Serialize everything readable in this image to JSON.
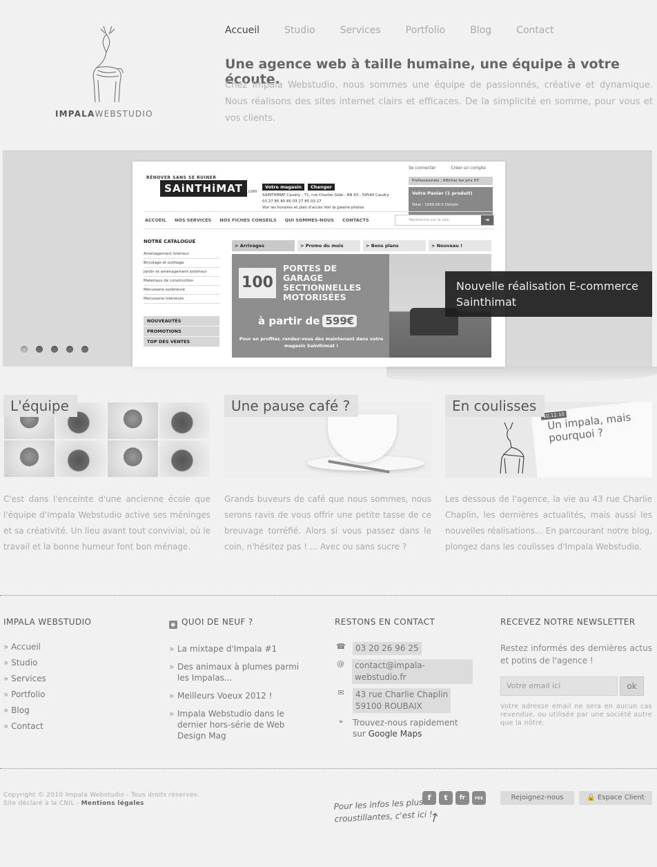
{
  "brand": {
    "name_bold": "IMPALA",
    "name_light": "WEBSTUDIO"
  },
  "nav": [
    {
      "label": "Accueil",
      "active": true
    },
    {
      "label": "Studio"
    },
    {
      "label": "Services"
    },
    {
      "label": "Portfolio"
    },
    {
      "label": "Blog"
    },
    {
      "label": "Contact"
    }
  ],
  "intro": {
    "title": "Une agence web à taille humaine, une équipe à votre écoute.",
    "text": "Chez Impala Webstudio, nous sommes une équipe de passionnés, créative et dynamique. Nous réalisons des sites internet clairs et efficaces. De la simplicité en somme, pour vous et vos clients."
  },
  "slider": {
    "caption_line1": "Nouvelle réalisation E-commerce",
    "caption_line2": "Sainthimat",
    "dots_active": 1,
    "shot": {
      "top_links": [
        "Se connecter",
        "Créer un compte"
      ],
      "brand_tag": "RÉNOVER SANS SE RUINER",
      "brand": "SAiNTHiMAT",
      "brand_www": "www.",
      "brand_com": ".com",
      "store_header": "Votre magasin",
      "store_change": "Changer",
      "store_line1": "SAINTHIMAT Caudry - 71, rue Charles Gide - RN 43 - 59540 Caudry",
      "store_line2": "03 27 85 85 85   03 27 85 03 27",
      "store_line3": "Voir les horaires et plan d'accès   Voir la galerie photos",
      "pro": "Professionnels : Afficher les prix HT",
      "cart_title": "Votre Panier (1 produit)",
      "cart_total": "Total : 1090.00 €     Détails",
      "menu": [
        "ACCUEIL",
        "NOS SERVICES",
        "NOS FICHES CONSEILS",
        "QUI SOMMES-NOUS",
        "CONTACTS"
      ],
      "search_placeholder": "Recherche sur le site",
      "catalog_title": "NOTRE CATALOGUE",
      "catalog": [
        "Aménagement intérieur",
        "Bricolage et outillage",
        "Jardin et aménagement extérieur",
        "Matériaux de construction",
        "Menuiserie extérieure",
        "Menuiserie intérieure"
      ],
      "promos": [
        "NOUVEAUTÉS",
        "PROMOTIONS",
        "TOP DES VENTES"
      ],
      "tabs": [
        "> Arrivages",
        "> Promo du mois",
        "> Bons plans",
        "> Nouveau !"
      ],
      "banner_num": "100",
      "banner_title": "PORTES DE GARAGE SECTIONNELLES MOTORISÉES",
      "banner_from": "à partir de",
      "banner_price": "599€",
      "banner_info": "Pour en profiter, rendez-vous dès maintenant dans votre magasin Sainthimat !"
    }
  },
  "columns": [
    {
      "title": "L'équipe",
      "text": "C'est dans l'enceinte d'une ancienne école que l'équipe d'Impala Webstudio active ses méninges et sa créativité. Un lieu avant tout convivial, où le travail et la bonne humeur font bon ménage."
    },
    {
      "title": "Une pause café ?",
      "text": "Grands buveurs de café que nous sommes, nous serons ravis de vous offrir une petite tasse de ce breuvage torréfié. Alors si vous passez dans le coin, n'hésitez pas ! ... Avec ou sans sucre ?"
    },
    {
      "title": "En coulisses",
      "blog_date": "10.12.10",
      "blog_title": "Un impala, mais pourquoi ?",
      "text": "Les dessous de l'agence, la vie au 43 rue Charlie Chaplin, les dernières actualités, mais aussi les nouvelles réalisations... En parcourant notre blog, plongez dans les coulisses d'Impala Webstudio."
    }
  ],
  "footer": {
    "col1": {
      "title": "IMPALA WEBSTUDIO",
      "links": [
        "Accueil",
        "Studio",
        "Services",
        "Portfolio",
        "Blog",
        "Contact"
      ]
    },
    "col2": {
      "title": "QUOI DE NEUF ?",
      "items": [
        "La mixtape d'Impala #1",
        "Des animaux à plumes parmi les Impalas...",
        "Meilleurs Voeux 2012 !",
        "Impala Webstudio dans le dernier hors-série de Web Design Mag"
      ]
    },
    "col3": {
      "title": "RESTONS EN CONTACT",
      "phone": "03 20 26 96 25",
      "email": "contact@impala-webstudio.fr",
      "address1": "43 rue Charlie Chaplin",
      "address2": "59100 ROUBAIX",
      "maps1": "Trouvez-nous rapidement",
      "maps2_prefix": "sur ",
      "maps2_link": "Google Maps"
    },
    "col4": {
      "title": "RECEVEZ NOTRE NEWSLETTER",
      "text": "Restez informés des dernières actus et potins de l'agence !",
      "placeholder": "Votre email ici",
      "ok": "ok",
      "note": "Votre adresse email ne sera en aucun cas revendue, ou utilisée par une société autre que la nôtre."
    },
    "copyright_line1": "Copyright © 2010 Impala Webstudio - Tous droits réservés.",
    "copyright_line2": "Site déclaré à la CNIL - ",
    "legal": "Mentions légales",
    "tagline1": "Pour les infos les plus",
    "tagline2": "croustillantes, c'est ici !",
    "socials": [
      "f",
      "t",
      "fr",
      "rss"
    ],
    "join": "Rejoignez-nous",
    "client": "Espace Client"
  }
}
